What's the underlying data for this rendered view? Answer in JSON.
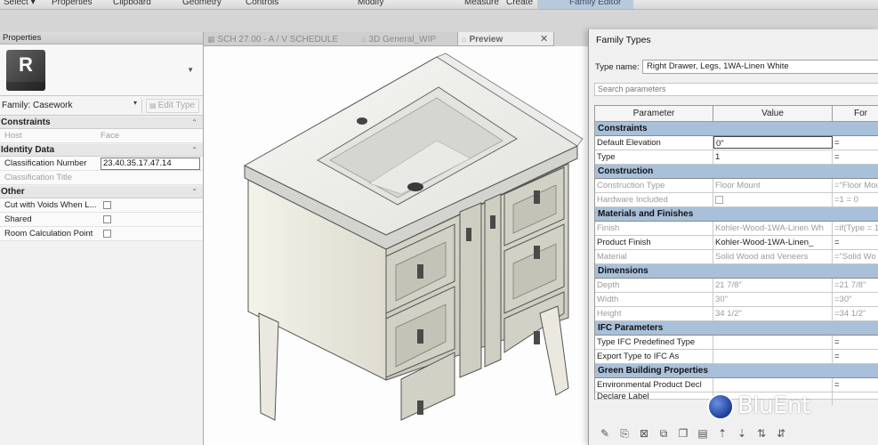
{
  "ribbon": {
    "tabs": [
      "Select ▾",
      "Properties",
      "Clipboard",
      "Geometry",
      "Controls",
      "Modify",
      "Measure",
      "Create",
      "Family Editor"
    ]
  },
  "properties": {
    "title": "Properties",
    "logo_letter": "R",
    "family_select": "Family: Casework",
    "edit_type": "Edit Type",
    "groups": [
      {
        "label": "Constraints",
        "rows": [
          {
            "key": "Host",
            "value": "Face",
            "dim": true
          }
        ]
      },
      {
        "label": "Identity Data",
        "rows": [
          {
            "key": "Classification Number",
            "value": "23.40.35.17.47.14",
            "boxed": true
          },
          {
            "key": "Classification Title",
            "value": "",
            "dim": true
          }
        ]
      },
      {
        "label": "Other",
        "rows": [
          {
            "key": "Cut with Voids When L...",
            "checkbox": true
          },
          {
            "key": "Shared",
            "checkbox": true
          },
          {
            "key": "Room Calculation Point",
            "checkbox": true
          }
        ]
      }
    ]
  },
  "view_tabs": [
    {
      "label": "SCH 27.00 - A / V SCHEDULE",
      "icon": "schedule-icon",
      "glyph": "▦"
    },
    {
      "label": "3D General_WIP",
      "icon": "home-3d-icon",
      "glyph": "⌂"
    },
    {
      "label": "Preview",
      "icon": "preview-3d-icon",
      "glyph": "⌂",
      "active": true
    }
  ],
  "tab_close": "✕",
  "family_types": {
    "title": "Family Types",
    "type_name_label": "Type name:",
    "type_name_value": "Right Drawer, Legs, 1WA-Linen White",
    "search_placeholder": "Search parameters",
    "columns": [
      "Parameter",
      "Value",
      "For"
    ],
    "sections": [
      {
        "label": "Constraints",
        "rows": [
          {
            "param": "Default Elevation",
            "value": "0\"",
            "formula": "=",
            "editing": true
          },
          {
            "param": "Type",
            "value": "1",
            "formula": "="
          }
        ]
      },
      {
        "label": "Construction",
        "rows": [
          {
            "param": "Construction Type",
            "value": "Floor Mount",
            "formula": "=\"Floor Mou",
            "dim": true
          },
          {
            "param": "Hardware Included",
            "checkbox": true,
            "formula": "=1 = 0",
            "dim": true
          }
        ]
      },
      {
        "label": "Materials and Finishes",
        "rows": [
          {
            "param": "Finish",
            "value": "Kohler-Wood-1WA-Linen Wh",
            "formula": "=if(Type = 1",
            "dim": true
          },
          {
            "param": "Product Finish",
            "value": "Kohler-Wood-1WA-Linen_",
            "formula": "="
          },
          {
            "param": "Material",
            "value": "Solid Wood and Veneers",
            "formula": "=\"Solid Wo",
            "dim": true
          }
        ]
      },
      {
        "label": "Dimensions",
        "rows": [
          {
            "param": "Depth",
            "value": "21 7/8\"",
            "formula": "=21 7/8\"",
            "dim": true
          },
          {
            "param": "Width",
            "value": "30\"",
            "formula": "=30\"",
            "dim": true
          },
          {
            "param": "Height",
            "value": "34 1/2\"",
            "formula": "=34 1/2\"",
            "dim": true
          }
        ]
      },
      {
        "label": "IFC Parameters",
        "rows": [
          {
            "param": "Type IFC Predefined Type",
            "value": "",
            "formula": "="
          },
          {
            "param": "Export Type to IFC As",
            "value": "",
            "formula": "="
          }
        ]
      },
      {
        "label": "Green Building Properties",
        "rows": [
          {
            "param": "Environmental Product Decl",
            "value": "",
            "formula": "="
          },
          {
            "param": "Declare Label",
            "value": "",
            "formula": ""
          }
        ]
      }
    ],
    "toolbar": [
      {
        "name": "pencil-icon",
        "glyph": "✎"
      },
      {
        "name": "new-parameter-icon",
        "glyph": "⎘"
      },
      {
        "name": "delete-parameter-icon",
        "glyph": "⊠"
      },
      {
        "name": "copy-icon",
        "glyph": "⧉"
      },
      {
        "name": "paste-icon",
        "glyph": "❐"
      },
      {
        "name": "rename-icon",
        "glyph": "▤"
      },
      {
        "name": "move-up-icon",
        "glyph": "⇡"
      },
      {
        "name": "move-down-icon",
        "glyph": "⇣"
      },
      {
        "name": "sort-ascending-icon",
        "glyph": "⇅"
      },
      {
        "name": "sort-descending-icon",
        "glyph": "⇵"
      }
    ]
  },
  "brand": {
    "text": "BluEnt",
    "colors": {
      "globe": "#1d3f9a",
      "text": "#ffffff"
    }
  },
  "colors": {
    "section_header": "#a8c0da",
    "ribbon_editor": "#b9c9dc"
  }
}
